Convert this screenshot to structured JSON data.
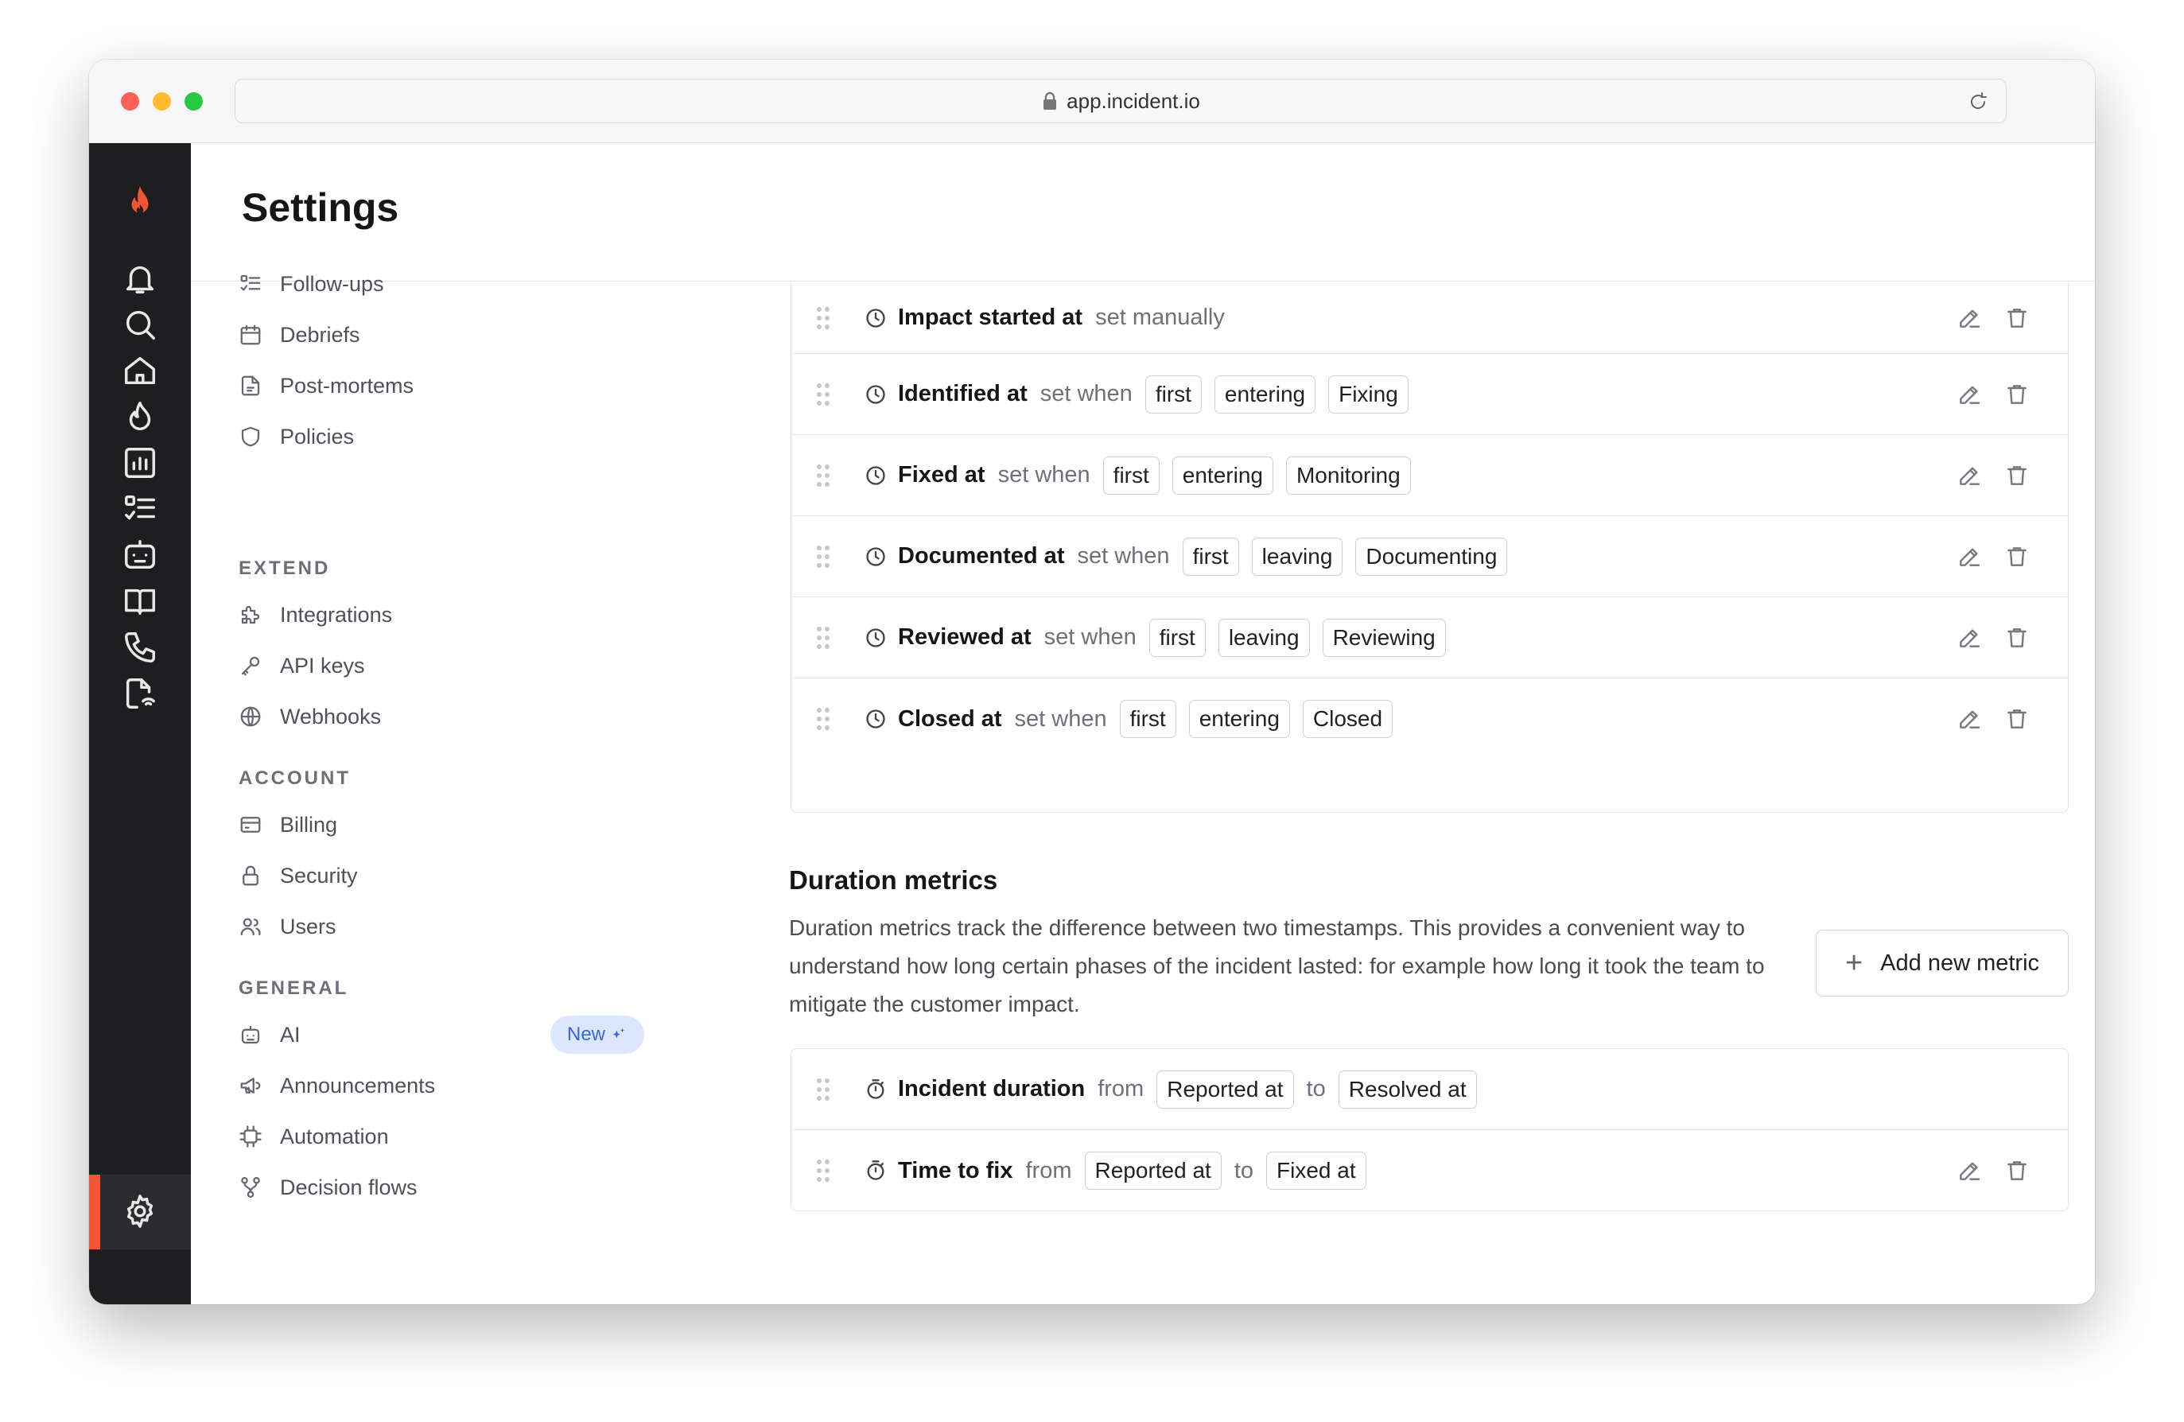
{
  "browser": {
    "url": "app.incident.io"
  },
  "header": {
    "title": "Settings"
  },
  "nav": {
    "items_top": [
      {
        "label": "Follow-ups",
        "icon": "checklist-icon"
      },
      {
        "label": "Debriefs",
        "icon": "calendar-icon"
      },
      {
        "label": "Post-mortems",
        "icon": "document-icon"
      },
      {
        "label": "Policies",
        "icon": "shield-icon"
      }
    ],
    "extend_title": "EXTEND",
    "extend": [
      {
        "label": "Integrations",
        "icon": "puzzle-icon"
      },
      {
        "label": "API keys",
        "icon": "key-icon"
      },
      {
        "label": "Webhooks",
        "icon": "globe-icon"
      }
    ],
    "account_title": "ACCOUNT",
    "account": [
      {
        "label": "Billing",
        "icon": "credit-card-icon"
      },
      {
        "label": "Security",
        "icon": "lock-icon"
      },
      {
        "label": "Users",
        "icon": "users-icon"
      }
    ],
    "general_title": "GENERAL",
    "general": [
      {
        "label": "AI",
        "icon": "robot-icon"
      },
      {
        "label": "Announcements",
        "icon": "megaphone-icon"
      },
      {
        "label": "Automation",
        "icon": "chip-icon"
      },
      {
        "label": "Decision flows",
        "icon": "flow-icon"
      }
    ],
    "ai_badge": "New"
  },
  "timestamps": [
    {
      "name": "Impact started at",
      "rule": "set manually",
      "chips": []
    },
    {
      "name": "Identified at",
      "rule": "set when",
      "chips": [
        "first",
        "entering",
        "Fixing"
      ]
    },
    {
      "name": "Fixed at",
      "rule": "set when",
      "chips": [
        "first",
        "entering",
        "Monitoring"
      ]
    },
    {
      "name": "Documented at",
      "rule": "set when",
      "chips": [
        "first",
        "leaving",
        "Documenting"
      ]
    },
    {
      "name": "Reviewed at",
      "rule": "set when",
      "chips": [
        "first",
        "leaving",
        "Reviewing"
      ]
    },
    {
      "name": "Closed at",
      "rule": "set when",
      "chips": [
        "first",
        "entering",
        "Closed"
      ]
    }
  ],
  "duration": {
    "title": "Duration metrics",
    "description": "Duration metrics track the difference between two timestamps. This provides a convenient way to understand how long certain phases of the incident lasted: for example how long it took the team to mitigate the customer impact.",
    "add_button": "Add new metric",
    "from_word": "from",
    "to_word": "to",
    "metrics": [
      {
        "name": "Incident duration",
        "from": "Reported at",
        "to": "Resolved at",
        "actions": false
      },
      {
        "name": "Time to fix",
        "from": "Reported at",
        "to": "Fixed at",
        "actions": true
      }
    ]
  },
  "colors": {
    "accent": "#f25533",
    "rail": "#1e1e20",
    "badge_bg": "#dce7ff",
    "badge_text": "#3565e6"
  }
}
